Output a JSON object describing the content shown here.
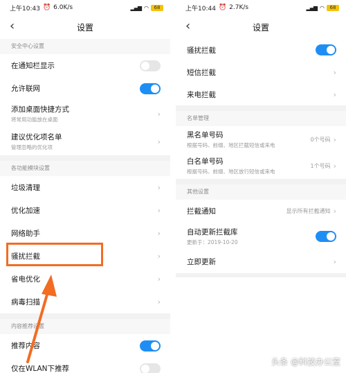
{
  "left": {
    "status": {
      "time": "上午10:43",
      "speed": "6.0K/s",
      "battery": "68"
    },
    "title": "设置",
    "sections": [
      {
        "header": "安全中心设置",
        "rows": [
          {
            "title": "在通知栏显示",
            "toggle": "off"
          },
          {
            "title": "允许联网",
            "toggle": "on"
          },
          {
            "title": "添加桌面快捷方式",
            "sub": "将常用功能放在桌面"
          },
          {
            "title": "建议优化项名单",
            "sub": "管理忽略的优化项"
          }
        ]
      },
      {
        "header": "各功能模块设置",
        "rows": [
          {
            "title": "垃圾清理"
          },
          {
            "title": "优化加速"
          },
          {
            "title": "网络助手"
          },
          {
            "title": "骚扰拦截"
          },
          {
            "title": "省电优化"
          },
          {
            "title": "病毒扫描"
          }
        ]
      },
      {
        "header": "内容推荐设置",
        "rows": [
          {
            "title": "推荐内容",
            "toggle": "on"
          },
          {
            "title": "仅在WLAN下推荐",
            "toggle": "off"
          }
        ]
      }
    ]
  },
  "right": {
    "status": {
      "time": "上午10:44",
      "speed": "2.7K/s",
      "battery": "68"
    },
    "title": "设置",
    "top_rows": [
      {
        "title": "骚扰拦截",
        "toggle": "on"
      },
      {
        "title": "短信拦截"
      },
      {
        "title": "来电拦截"
      }
    ],
    "sections": [
      {
        "header": "名单管理",
        "rows": [
          {
            "title": "黑名单号码",
            "sub": "根据号码、前缀、地区拦截短信或来电",
            "value": "0个号码"
          },
          {
            "title": "白名单号码",
            "sub": "根据号码、前缀、地区放行短信或来电",
            "value": "1个号码"
          }
        ]
      },
      {
        "header": "其他设置",
        "rows": [
          {
            "title": "拦截通知",
            "value": "显示所有拦截通知"
          },
          {
            "title": "自动更新拦截库",
            "sub": "更新于：2019-10-20",
            "toggle": "on"
          },
          {
            "title": "立即更新"
          }
        ]
      }
    ]
  },
  "watermark": "头条 @科技办公室",
  "colors": {
    "accent": "#1e8ef5",
    "highlight": "#f26c22"
  }
}
